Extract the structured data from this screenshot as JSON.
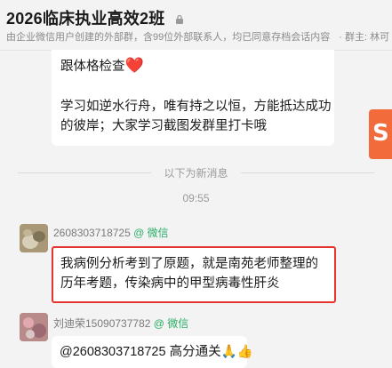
{
  "header": {
    "title": "2026临床执业高效2班",
    "subtitle": "由企业微信用户创建的外部群，含99位外部联系人，均已同意存档会话内容",
    "owner_label": "· 群主: 林可"
  },
  "messages": [
    {
      "line1": "跟体格检查",
      "line1_emoji": "❤️",
      "line2": "学习如逆水行舟，唯有持之以恒，方能抵达成功的彼岸；大家学习截图发群里打卡哦"
    },
    {
      "sender": "2608303718725",
      "source": "@ 微信",
      "text": "我病例分析考到了原题，就是南苑老师整理的历年考题，传染病中的甲型病毒性肝炎"
    },
    {
      "sender": "刘迪荣15090737782",
      "source": "@ 微信",
      "text": "@2608303718725 高分通关🙏👍"
    }
  ],
  "divider_text": "以下为新消息",
  "timestamp": "09:55",
  "brand_letter": "S"
}
